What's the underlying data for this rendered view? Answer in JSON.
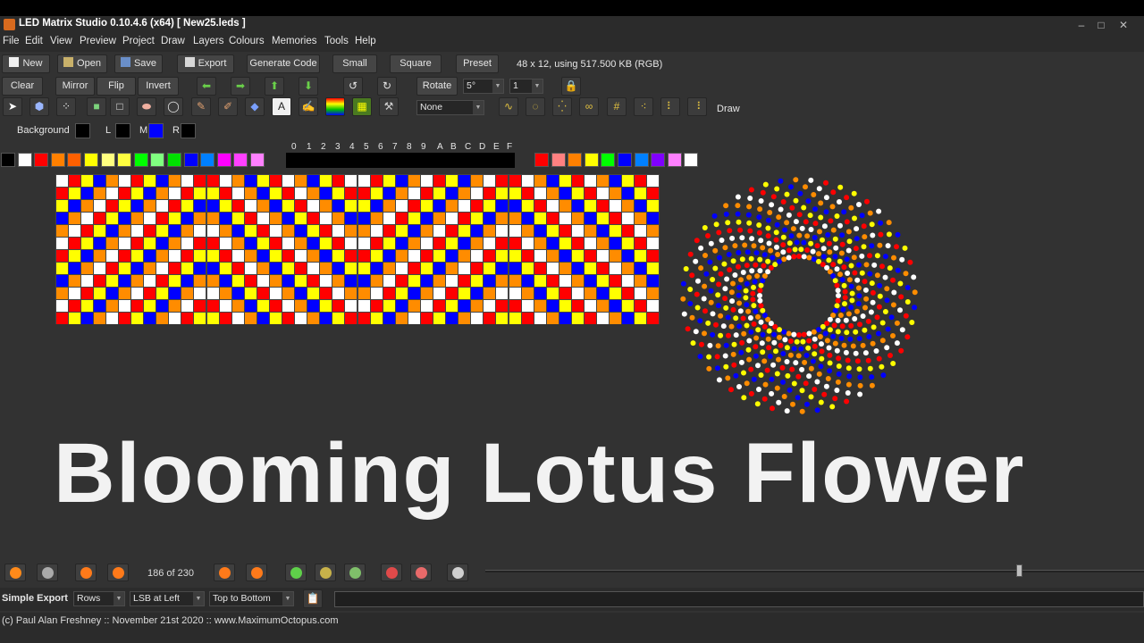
{
  "window": {
    "title": "LED Matrix Studio 0.10.4.6 (x64)  [ New25.leds ]",
    "minimize": "–",
    "maximize": "□",
    "close": "✕"
  },
  "menu": [
    "File",
    "Edit",
    "View",
    "Preview",
    "Project",
    "Draw",
    "Layers",
    "Colours",
    "Memories",
    "Tools",
    "Help"
  ],
  "toolbar1": {
    "new": "New",
    "open": "Open",
    "save": "Save",
    "export": "Export",
    "generate_code": "Generate Code",
    "small": "Small",
    "square": "Square",
    "preset": "Preset",
    "matrix_info": "48 x 12, using 517.500 KB (RGB)"
  },
  "toolbar2": {
    "clear": "Clear",
    "mirror": "Mirror",
    "flip": "Flip",
    "invert": "Invert",
    "rotate": "Rotate",
    "rotate_angle": "5°",
    "rotate_count": "1"
  },
  "toolbar3": {
    "gradient_value": "None",
    "mode_label": "Draw"
  },
  "colour_row": {
    "background_label": "Background",
    "l_label": "L",
    "m_label": "M",
    "r_label": "R",
    "background": "#000000",
    "left": "#000000",
    "middle": "#0000ff",
    "right": "#000000"
  },
  "memory_labels": [
    "0",
    "1",
    "2",
    "3",
    "4",
    "5",
    "6",
    "7",
    "8",
    "9",
    "A",
    "B",
    "C",
    "D",
    "E",
    "F"
  ],
  "palette_left": [
    "#000000",
    "#ffffff",
    "#ff0000",
    "#ff8000",
    "#ff6000",
    "#ffff00",
    "#ffff80",
    "#ffff40",
    "#00ff00",
    "#80ff80",
    "#00e000",
    "#0000ff",
    "#0080ff",
    "#ff00ff",
    "#ff40ff",
    "#ff80ff"
  ],
  "palette_right": [
    "#ff0000",
    "#ff8080",
    "#ff8000",
    "#ffff00",
    "#00ff00",
    "#0000ff",
    "#0080ff",
    "#8000ff",
    "#ff80ff",
    "#ffffff"
  ],
  "matrix": {
    "columns": 48,
    "rows": 12,
    "color_sequence": [
      "#ffffff",
      "#ff0000",
      "#ffff00",
      "#0000ff",
      "#ff8c00"
    ],
    "gap_color": "#444444"
  },
  "flower": {
    "colors": [
      "#ffffff",
      "#ff0000",
      "#ffff00",
      "#0000ff",
      "#ff8c00"
    ]
  },
  "headline": "Blooming Lotus Flower",
  "animation": {
    "frame_counter": "186 of 230",
    "position_fraction": 0.81
  },
  "export_bar": {
    "label": "Simple Export",
    "direction": "Rows",
    "bit_order": "LSB at Left",
    "scan": "Top to Bottom"
  },
  "status": "(c) Paul Alan Freshney :: November 21st 2020 :: www.MaximumOctopus.com"
}
